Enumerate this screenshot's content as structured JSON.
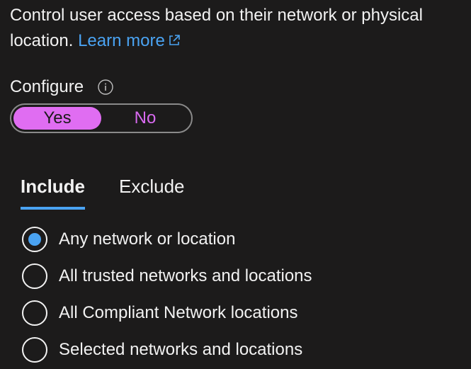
{
  "description": {
    "text": "Control user access based on their network or physical location.",
    "learn_more_label": "Learn more",
    "link_icon": "external-link-icon"
  },
  "configure": {
    "label": "Configure",
    "info_icon": "info-icon",
    "toggle": {
      "yes_label": "Yes",
      "no_label": "No",
      "selected": "Yes"
    }
  },
  "tabs": [
    {
      "label": "Include",
      "active": true
    },
    {
      "label": "Exclude",
      "active": false
    }
  ],
  "options": [
    {
      "label": "Any network or location",
      "selected": true
    },
    {
      "label": "All trusted networks and locations",
      "selected": false
    },
    {
      "label": "All Compliant Network locations",
      "selected": false
    },
    {
      "label": "Selected networks and locations",
      "selected": false
    }
  ],
  "colors": {
    "background": "#1c1b1b",
    "accent_blue": "#4aa3f2",
    "toggle_pink": "#e06df2",
    "text": "#f2f2f2"
  }
}
